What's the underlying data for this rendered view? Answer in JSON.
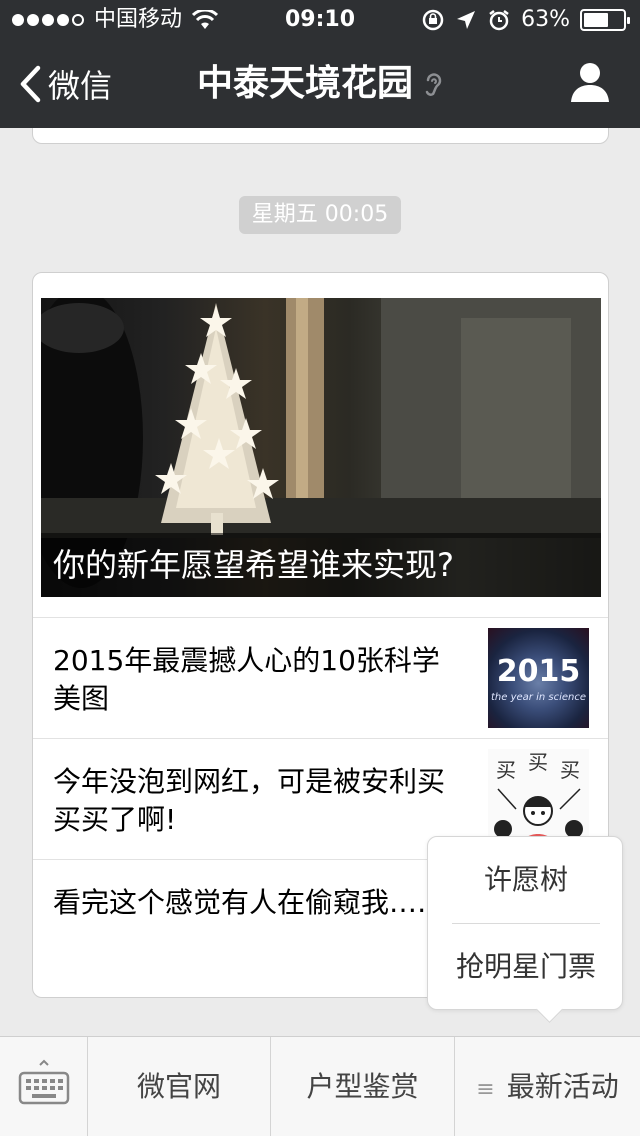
{
  "status_bar": {
    "carrier": "中国移动",
    "time": "09:10",
    "battery_percent": "63%",
    "battery_level": 0.63
  },
  "nav": {
    "back_label": "微信",
    "title": "中泰天境花园"
  },
  "chat": {
    "timestamp": "星期五 00:05",
    "cover_article": {
      "title": "你的新年愿望希望谁来实现?"
    },
    "articles": [
      {
        "title": "2015年最震撼人心的10张科学美图",
        "thumb_text": "2015",
        "thumb_subtext": "the year in science"
      },
      {
        "title": "今年没泡到网红，可是被安利买买买了啊!"
      },
      {
        "title": "看完这个感觉有人在偷窥我……"
      }
    ]
  },
  "popup_menu": {
    "items": [
      "许愿树",
      "抢明星门票"
    ]
  },
  "bottom_menu": {
    "items": [
      "微官网",
      "户型鉴赏",
      "最新活动"
    ],
    "hamburger_glyph": "≡"
  },
  "colors": {
    "navbar_bg": "#2e3033",
    "chat_bg": "#ebebeb",
    "menubar_bg": "#f7f7f7"
  }
}
